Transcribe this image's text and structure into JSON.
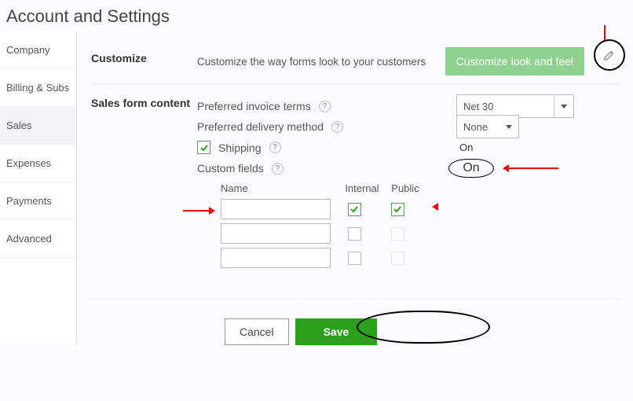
{
  "page_title": "Account and Settings",
  "sidebar": {
    "items": [
      {
        "label": "Company"
      },
      {
        "label": "Billing & Subs"
      },
      {
        "label": "Sales"
      },
      {
        "label": "Expenses"
      },
      {
        "label": "Payments"
      },
      {
        "label": "Advanced"
      }
    ],
    "active_index": 2
  },
  "customize": {
    "section_label": "Customize",
    "description": "Customize the way forms look to your customers",
    "button_label": "Customize look and feel"
  },
  "sales_form": {
    "section_label": "Sales form content",
    "pref_invoice_terms_label": "Preferred invoice terms",
    "pref_invoice_terms_value": "Net 30",
    "pref_delivery_label": "Preferred delivery method",
    "pref_delivery_value": "None",
    "shipping_label": "Shipping",
    "shipping_checked": true,
    "shipping_status": "On",
    "custom_fields_label": "Custom fields",
    "custom_fields_status": "On",
    "cf_headers": {
      "name": "Name",
      "internal": "Internal",
      "public": "Public"
    },
    "cf_rows": [
      {
        "name": "",
        "internal": true,
        "public": true
      },
      {
        "name": "",
        "internal": false,
        "public": false
      },
      {
        "name": "",
        "internal": false,
        "public": false
      }
    ]
  },
  "footer": {
    "cancel_label": "Cancel",
    "save_label": "Save"
  }
}
